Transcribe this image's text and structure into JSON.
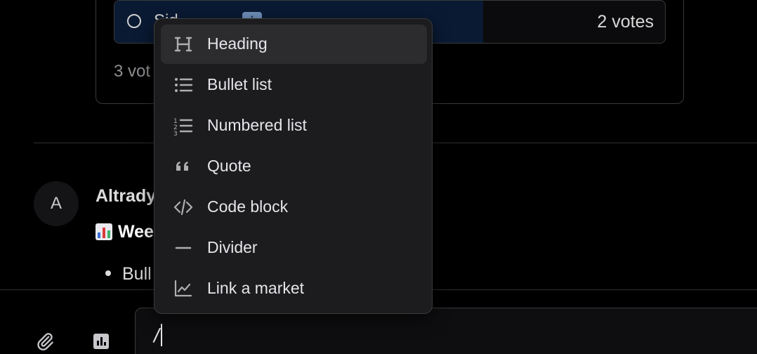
{
  "poll": {
    "option_label": "Sid",
    "option_emoji": "ℹ",
    "option_votes": "2 votes",
    "option_fraction": 0.67,
    "total_votes": "3 vot"
  },
  "message": {
    "avatar_initial": "A",
    "author": "Altrady",
    "title": "Wee",
    "bullet": "Bull"
  },
  "composer": {
    "text": "/"
  },
  "slash_menu": {
    "items": [
      {
        "label": "Heading",
        "icon": "heading-icon"
      },
      {
        "label": "Bullet list",
        "icon": "bullet-list-icon"
      },
      {
        "label": "Numbered list",
        "icon": "numbered-list-icon"
      },
      {
        "label": "Quote",
        "icon": "quote-icon"
      },
      {
        "label": "Code block",
        "icon": "code-block-icon"
      },
      {
        "label": "Divider",
        "icon": "divider-icon"
      },
      {
        "label": "Link a market",
        "icon": "chart-line-icon"
      }
    ]
  },
  "colors": {
    "background": "#000000",
    "menu_background": "#1c1c1e",
    "menu_active": "#2c2c2e",
    "poll_fill": "#0a1a33",
    "border": "#3a3a3c"
  }
}
